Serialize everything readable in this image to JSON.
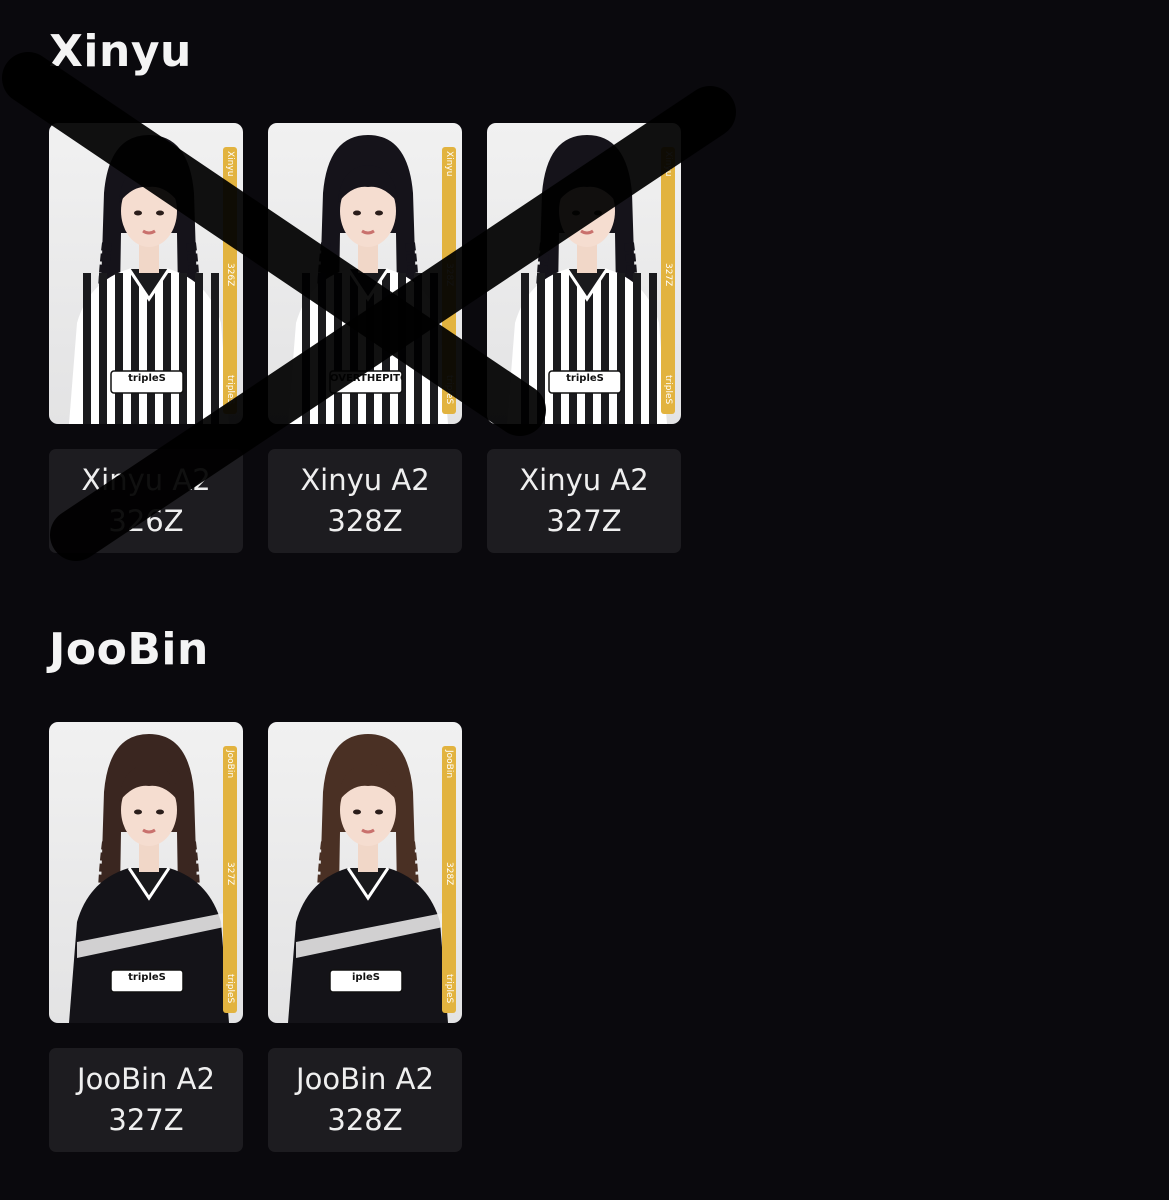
{
  "groups": [
    {
      "title": "Xinyu",
      "cards": [
        {
          "name": "Xinyu A2",
          "serial": "326Z",
          "band_member": "Xinyu",
          "band_serial": "326Z",
          "band_brand": "tripleS",
          "crossed_out": true,
          "hair": "#15131a",
          "jersey": "striped",
          "jersey_text": "tripleS"
        },
        {
          "name": "Xinyu A2",
          "serial": "328Z",
          "band_member": "Xinyu",
          "band_serial": "328Z",
          "band_brand": "tripleS",
          "crossed_out": true,
          "hair": "#15131a",
          "jersey": "striped",
          "jersey_text": "OVERTHEPITCH"
        },
        {
          "name": "Xinyu A2",
          "serial": "327Z",
          "band_member": "Xinyu",
          "band_serial": "327Z",
          "band_brand": "tripleS",
          "crossed_out": true,
          "hair": "#15131a",
          "jersey": "striped",
          "jersey_text": "tripleS"
        }
      ]
    },
    {
      "title": "JooBin",
      "cards": [
        {
          "name": "JooBin A2",
          "serial": "327Z",
          "band_member": "JooBin",
          "band_serial": "327Z",
          "band_brand": "tripleS",
          "crossed_out": false,
          "hair": "#3a2620",
          "jersey": "dark",
          "jersey_text": "tripleS"
        },
        {
          "name": "JooBin A2",
          "serial": "328Z",
          "band_member": "JooBin",
          "band_serial": "328Z",
          "band_brand": "tripleS",
          "crossed_out": false,
          "hair": "#4a3024",
          "jersey": "dark",
          "jersey_text": "ipleS"
        }
      ]
    }
  ],
  "colors": {
    "background": "#0a090d",
    "label_bg": "#1d1c20",
    "band_accent": "#e2b33f",
    "strike": "#000000"
  }
}
